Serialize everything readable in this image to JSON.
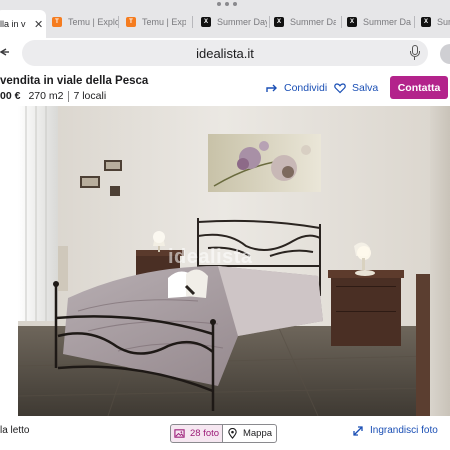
{
  "browser": {
    "tabs": [
      {
        "label": "lla in v",
        "favicon": "page-icon",
        "active": true
      },
      {
        "label": "Temu | Explo",
        "favicon": "temu-icon"
      },
      {
        "label": "Temu | Explo",
        "favicon": "temu-icon"
      },
      {
        "label": "Summer Day",
        "favicon": "x-icon"
      },
      {
        "label": "Summer Day",
        "favicon": "x-icon"
      },
      {
        "label": "Summer Day",
        "favicon": "x-icon"
      },
      {
        "label": "Sum",
        "favicon": "x-icon"
      }
    ],
    "close_glyph": "✕",
    "url": "idealista.it"
  },
  "listing": {
    "title": "vendita in viale della Pesca",
    "price": "00 €",
    "area": "270 m2",
    "rooms": "7 locali",
    "share_label": "Condividi",
    "save_label": "Salva",
    "contact_label": "Contatta"
  },
  "photo": {
    "watermark": "idealista",
    "caption": "la letto"
  },
  "footer": {
    "photos_label": "28 foto",
    "map_label": "Mappa",
    "enlarge_label": "Ingrandisci foto"
  },
  "colors": {
    "accent_blue": "#1a4fb5",
    "brand_magenta": "#b3238b",
    "photos_tint": "#f6e7f1"
  }
}
